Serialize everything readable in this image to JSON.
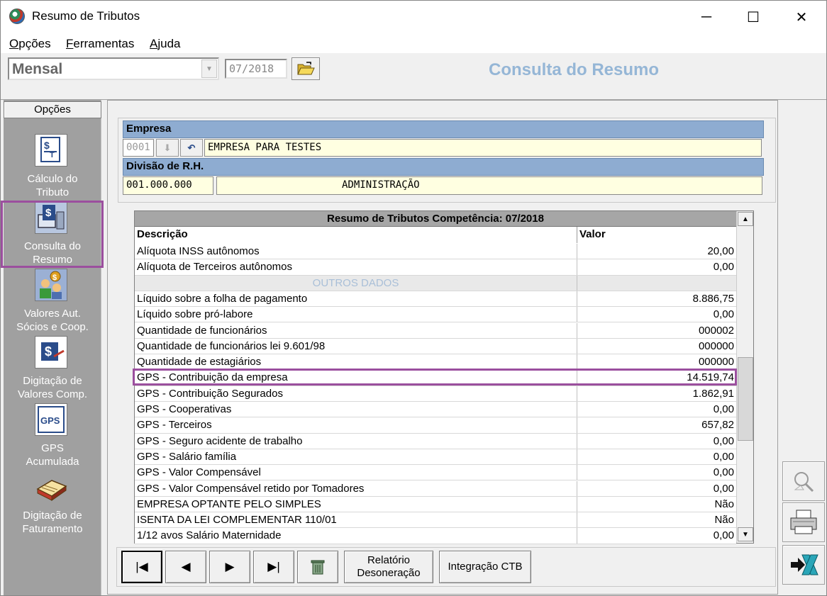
{
  "window": {
    "title": "Resumo de Tributos",
    "minimize": "─",
    "maximize": "☐",
    "close": "✕"
  },
  "menu": [
    {
      "label_first": "O",
      "label_rest": "pções"
    },
    {
      "label_first": "F",
      "label_rest": "erramentas"
    },
    {
      "label_first": "A",
      "label_rest": "juda"
    }
  ],
  "toolbar": {
    "period": "Mensal",
    "month": "07/2018",
    "heading": "Consulta do Resumo"
  },
  "sidebar": {
    "header": "Opções",
    "items": [
      {
        "label1": "Cálculo do",
        "label2": "Tributo",
        "icon": "calculator-icon",
        "icon_text": "$"
      },
      {
        "label1": "Consulta do",
        "label2": "Resumo",
        "icon": "computer-money-icon",
        "icon_text": "$"
      },
      {
        "label1": "Valores Aut.",
        "label2": "Sócios e  Coop.",
        "icon": "people-money-icon",
        "icon_text": "$"
      },
      {
        "label1": "Digitação de",
        "label2": "Valores Comp.",
        "icon": "money-edit-icon",
        "icon_text": "$"
      },
      {
        "label1": "GPS",
        "label2": "Acumulada",
        "icon": "gps-icon",
        "icon_text": "GPS"
      },
      {
        "label1": "Digitação de",
        "label2": "Faturamento",
        "icon": "invoice-book-icon",
        "icon_text": ""
      }
    ]
  },
  "company": {
    "header": "Empresa",
    "code": "0001",
    "name": "EMPRESA PARA TESTES",
    "division_header": "Divisão de R.H.",
    "division_code": "001.000.000",
    "division_name": "ADMINISTRAÇÃO"
  },
  "grid": {
    "title": "Resumo de Tributos Competência: 07/2018",
    "col_desc": "Descrição",
    "col_value": "Valor",
    "rows": [
      {
        "d": "Alíquota INSS autônomos",
        "v": "20,00"
      },
      {
        "d": "Alíquota de Terceiros autônomos",
        "v": "0,00"
      },
      {
        "d": "OUTROS DADOS",
        "v": "",
        "section": true
      },
      {
        "d": "Líquido sobre a folha de pagamento",
        "v": "8.886,75"
      },
      {
        "d": "Líquido sobre pró-labore",
        "v": "0,00"
      },
      {
        "d": "Quantidade de funcionários",
        "v": "000002"
      },
      {
        "d": "Quantidade de funcionários lei 9.601/98",
        "v": "000000"
      },
      {
        "d": "Quantidade de estagiários",
        "v": "000000"
      },
      {
        "d": "GPS - Contribuição da empresa",
        "v": "14.519,74"
      },
      {
        "d": "GPS - Contribuição Segurados",
        "v": "1.862,91"
      },
      {
        "d": "GPS - Cooperativas",
        "v": "0,00"
      },
      {
        "d": "GPS - Terceiros",
        "v": "657,82"
      },
      {
        "d": "GPS - Seguro acidente de trabalho",
        "v": "0,00"
      },
      {
        "d": "GPS - Salário família",
        "v": "0,00"
      },
      {
        "d": "GPS - Valor Compensável",
        "v": "0,00"
      },
      {
        "d": "GPS - Valor Compensável retido por Tomadores",
        "v": "0,00"
      },
      {
        "d": "EMPRESA OPTANTE PELO SIMPLES",
        "v": "Não"
      },
      {
        "d": "ISENTA DA LEI COMPLEMENTAR 110/01",
        "v": "Não"
      },
      {
        "d": "1/12 avos Salário Maternidade",
        "v": "0,00"
      }
    ]
  },
  "nav": {
    "first": "|◀",
    "prev": "◀",
    "next": "▶",
    "last": "▶|",
    "report_line1": "Relatório",
    "report_line2": "Desoneração",
    "integration": "Integração CTB"
  }
}
